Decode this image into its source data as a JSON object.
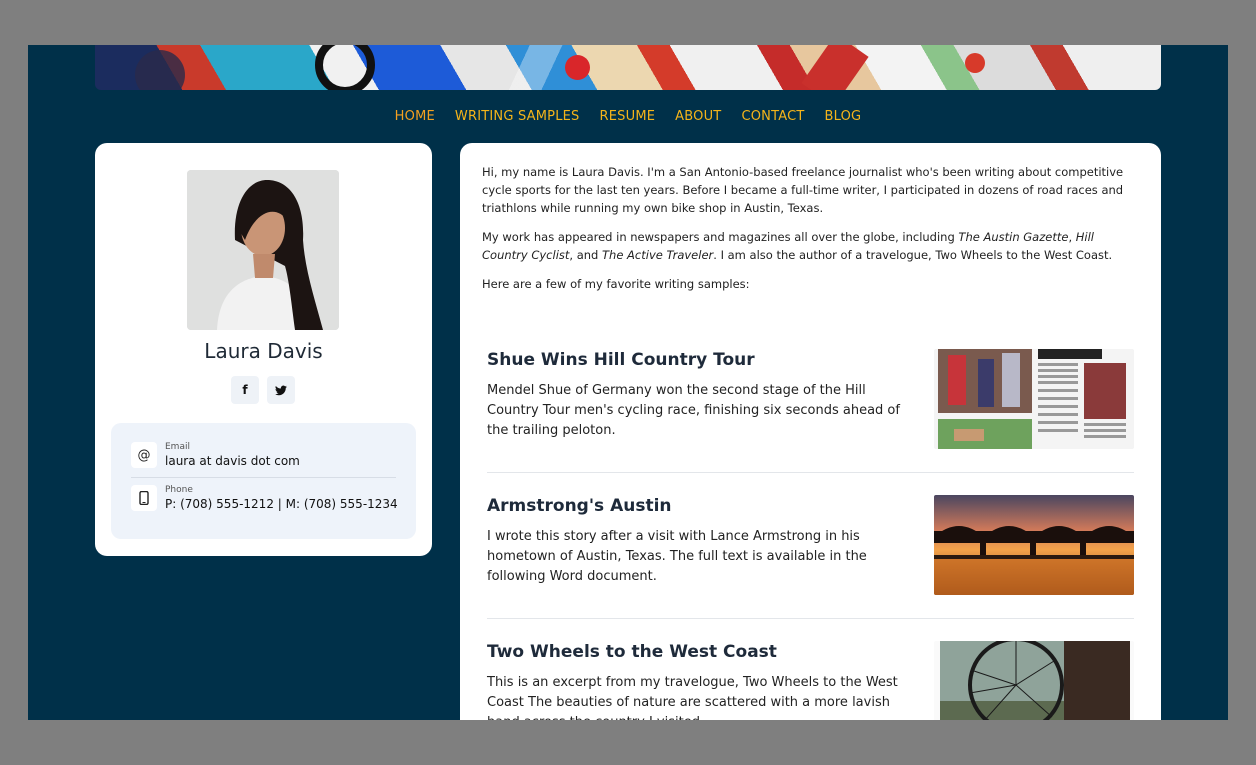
{
  "nav": [
    {
      "label": "HOME",
      "active": true
    },
    {
      "label": "WRITING SAMPLES"
    },
    {
      "label": "RESUME"
    },
    {
      "label": "ABOUT"
    },
    {
      "label": "CONTACT"
    },
    {
      "label": "BLOG"
    }
  ],
  "profile": {
    "name": "Laura Davis",
    "social": [
      {
        "icon": "facebook-icon",
        "glyph": "f"
      },
      {
        "icon": "twitter-icon",
        "glyph": "🐦"
      }
    ],
    "contact": {
      "email_label": "Email",
      "email_value": "laura at davis dot com",
      "phone_label": "Phone",
      "phone_value": "P: (708) 555-1212 | M: (708) 555-1234"
    }
  },
  "intro": {
    "p1": "Hi, my name is Laura Davis. I'm a San Antonio-based freelance journalist who's been writing about competitive cycle sports for the last ten years. Before I became a full-time writer, I participated in dozens of road races and triathlons while running my own bike shop in Austin, Texas.",
    "p2_a": "My work has appeared in newspapers and magazines all over the globe, including ",
    "p2_pub1": "The Austin Gazette",
    "p2_b": ", ",
    "p2_pub2": "Hill Country Cyclist",
    "p2_c": ", and ",
    "p2_pub3": "The Active Traveler",
    "p2_d": ". I am also the author of a travelogue, Two Wheels to the West Coast.",
    "p3": "Here are a few of my favorite writing samples:"
  },
  "articles": [
    {
      "title": "Shue Wins Hill Country Tour",
      "desc": "Mendel Shue of Germany won the second stage of the Hill Country Tour men's cycling race, finishing six seconds ahead of the trailing peloton."
    },
    {
      "title": "Armstrong's Austin",
      "desc": "I wrote this story after a visit with Lance Armstrong in his hometown of Austin, Texas. The full text is available in the following Word document."
    },
    {
      "title": "Two Wheels to the West Coast",
      "desc": "This is an excerpt from my travelogue, Two Wheels to the West Coast The beauties of nature are scattered with a more lavish hand across the country I visited."
    }
  ],
  "colors": {
    "background": "#003049",
    "nav": "#f4b41a",
    "card": "#ffffff"
  }
}
